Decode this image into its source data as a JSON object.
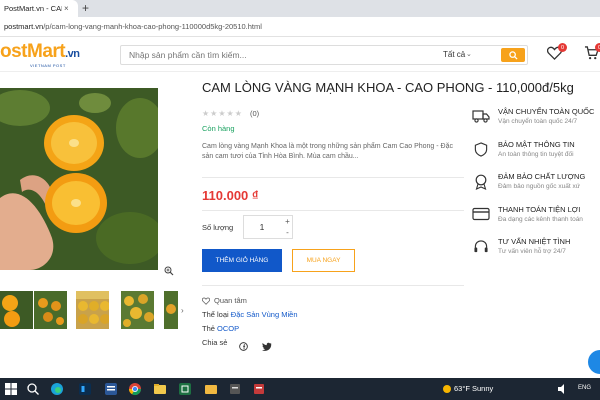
{
  "browser": {
    "tab_title": "PostMart.vn - CAM LÒNG VÀNG MẠNH KHOA",
    "tab_close": "×",
    "new_tab": "+",
    "url_domain": "postmart.vn",
    "url_path": "/p/cam-long-vang-manh-khoa-cao-phong-110000d5kg-20510.html"
  },
  "header": {
    "logo_main": "ostMart",
    "logo_suffix": ".vn",
    "logo_sub": "VIETNAM POST",
    "search_placeholder": "Nhập sản phẩm cần tìm kiếm...",
    "search_category": "Tất cả",
    "wishlist_count": "0",
    "cart_count": "0"
  },
  "product": {
    "title": "CAM LÒNG VÀNG MẠNH KHOA - CAO PHONG - 110,000đ/5kg",
    "stars": "★★★★★",
    "rating": 0,
    "review_count": "(0)",
    "stock_status": "Còn hàng",
    "description": "Cam lòng vàng Mạnh Khoa là một trong những sản phẩm Cam Cao Phong - Đặc sản cam tươi của Tỉnh Hòa Bình. Mùa cam chầu...",
    "price": "110.000 ₫",
    "quantity_label": "Số lượng",
    "quantity": "1",
    "add_to_cart": "THÊM GIỎ HÀNG",
    "buy_now": "MUA NGAY",
    "wishlist_label": "Quan tâm",
    "category_label": "Thể loại",
    "category_value": "Đặc Sản Vùng Miền",
    "tag_label": "Thẻ",
    "tag_value": "OCOP",
    "share_label": "Chia sẻ"
  },
  "services": [
    {
      "title": "VẬN CHUYỂN TOÀN QUỐC",
      "sub": "Vận chuyển toàn quốc 24/7",
      "icon": "truck-icon"
    },
    {
      "title": "BẢO MẬT THÔNG TIN",
      "sub": "An toàn thông tin tuyệt đối",
      "icon": "shield-icon"
    },
    {
      "title": "ĐẢM BẢO CHẤT LƯỢNG",
      "sub": "Đảm bảo nguồn gốc xuất xứ",
      "icon": "medal-icon"
    },
    {
      "title": "THANH TOÁN TIỆN LỢI",
      "sub": "Đa dạng các kênh thanh toán",
      "icon": "card-icon"
    },
    {
      "title": "TƯ VẤN NHIỆT TÌNH",
      "sub": "Tư vấn viên hỗ trợ 24/7",
      "icon": "headset-icon"
    }
  ],
  "taskbar": {
    "weather": "63°F  Sunny",
    "lang": "ENG"
  },
  "colors": {
    "brand_orange": "#f7a21b",
    "brand_blue": "#1158c9",
    "price_red": "#e53935"
  }
}
